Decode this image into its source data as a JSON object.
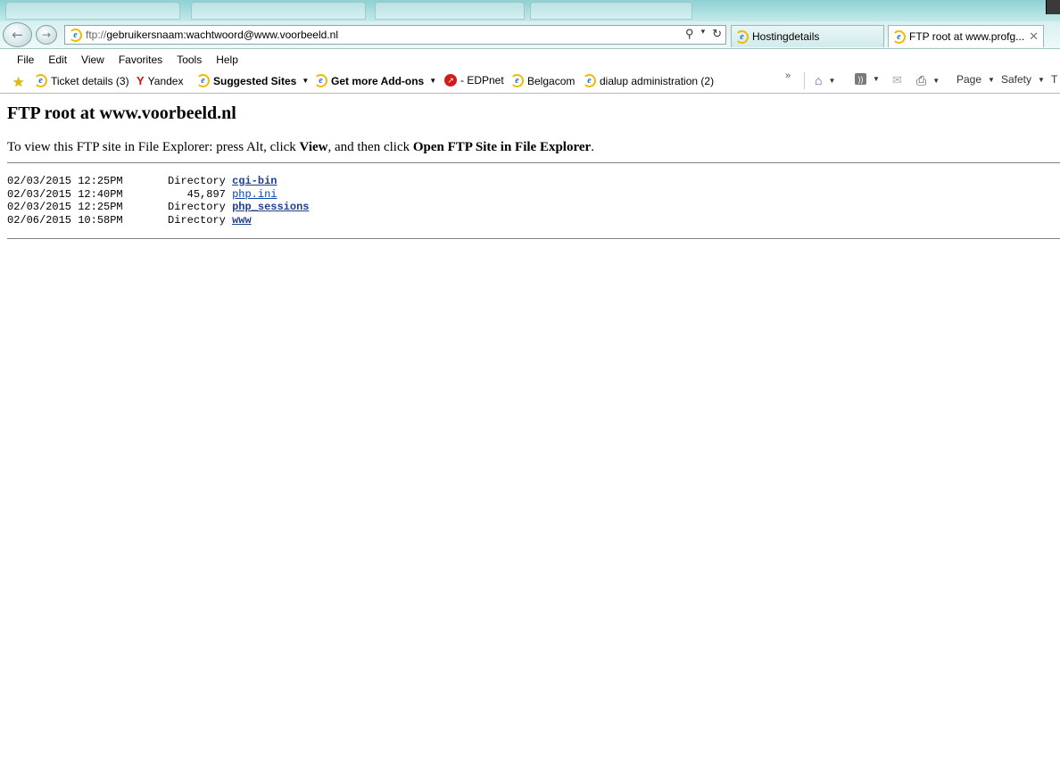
{
  "browser": {
    "address": {
      "protocol": "ftp://",
      "rest": "gebruikersnaam:wachtwoord@www.voorbeeld.nl"
    },
    "tabs": [
      {
        "label": "Hostingdetails",
        "active": false
      },
      {
        "label": "FTP root at www.profg...",
        "active": true
      }
    ],
    "menu": [
      "File",
      "Edit",
      "View",
      "Favorites",
      "Tools",
      "Help"
    ],
    "favorites": [
      {
        "label": "Ticket details (3)",
        "icon": "ie-page-icon"
      },
      {
        "label": "Yandex",
        "icon": "yandex-icon"
      },
      {
        "label": "Suggested Sites",
        "icon": "ie-page-icon",
        "dropdown": true
      },
      {
        "label": "Get more Add-ons",
        "icon": "ie-page-icon",
        "dropdown": true
      },
      {
        "label": "- EDPnet",
        "icon": "edpnet-icon"
      },
      {
        "label": "Belgacom",
        "icon": "ie-page-icon"
      },
      {
        "label": "dialup administration (2)",
        "icon": "ie-page-icon"
      }
    ],
    "more_chevron": "»",
    "commands": {
      "page": "Page",
      "safety": "Safety",
      "tools_cut": "T"
    }
  },
  "page": {
    "title": "FTP root at www.voorbeeld.nl",
    "instructions": {
      "prefix": "To view this FTP site in File Explorer: press Alt, click ",
      "view": "View",
      "middle": ", and then click ",
      "open": "Open FTP Site in File Explorer",
      "suffix": "."
    },
    "listing": [
      {
        "date": "02/03/2015 12:25PM",
        "size": "Directory",
        "name": "cgi-bin",
        "is_dir": true
      },
      {
        "date": "02/03/2015 12:40PM",
        "size": "45,897",
        "name": "php.ini",
        "is_dir": false
      },
      {
        "date": "02/03/2015 12:25PM",
        "size": "Directory",
        "name": "php_sessions",
        "is_dir": true
      },
      {
        "date": "02/06/2015 10:58PM",
        "size": "Directory",
        "name": "www",
        "is_dir": true
      }
    ]
  },
  "colors": {
    "link": "#0645ad",
    "chrome_teal": "#8fd0d3"
  }
}
